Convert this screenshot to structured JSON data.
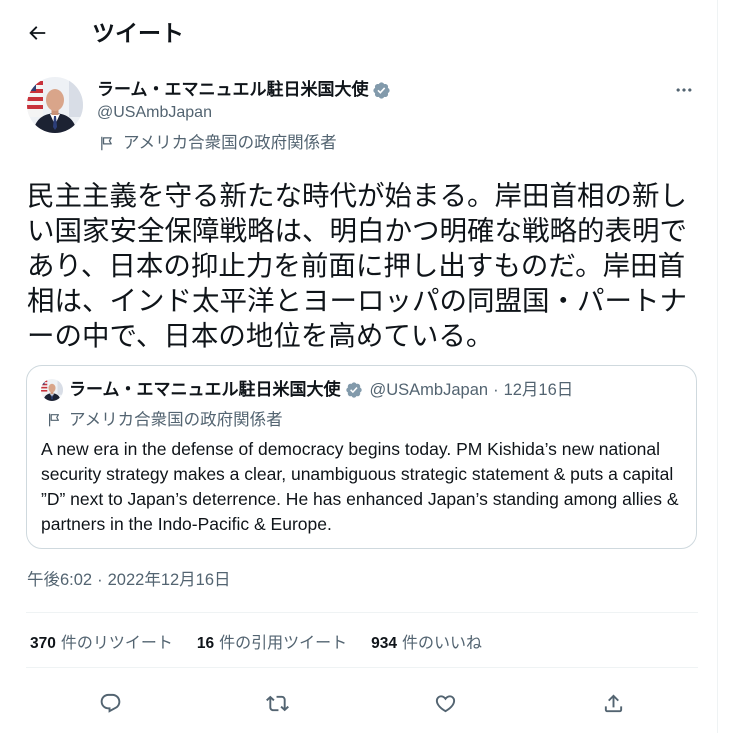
{
  "header": {
    "back_icon": "arrow-left-icon",
    "title": "ツイート"
  },
  "tweet": {
    "author": {
      "name": "ラーム・エマニュエル駐日米国大使",
      "handle": "@USAmbJapan",
      "badge_icon": "verified-badge-icon"
    },
    "more_icon": "more-icon",
    "label": {
      "icon": "flag-icon",
      "text": "アメリカ合衆国の政府関係者"
    },
    "text": "民主主義を守る新たな時代が始まる。岸田首相の新しい国家安全保障戦略は、明白かつ明確な戦略的表明であり、日本の抑止力を前面に押し出すものだ。岸田首相は、インド太平洋とヨーロッパの同盟国・パートナーの中で、日本の地位を高めている。",
    "quoted_tweet": {
      "author": {
        "name": "ラーム・エマニュエル駐日米国大使",
        "handle": "@USAmbJapan",
        "separator": "·",
        "date": "12月16日",
        "badge_icon": "verified-badge-icon"
      },
      "label": {
        "icon": "flag-icon",
        "text": "アメリカ合衆国の政府関係者"
      },
      "text": "A new era in the defense of democracy begins today. PM Kishida’s new national security strategy makes a clear, unambiguous strategic statement & puts a capital ”D” next to Japan’s deterrence. He has enhanced Japan’s standing among allies & partners in the Indo-Pacific & Europe."
    },
    "timestamp": {
      "time": "午後6:02",
      "separator": "·",
      "date": "2022年12月16日"
    },
    "stats": [
      {
        "count": "370",
        "label": "件のリツイート"
      },
      {
        "count": "16",
        "label": "件の引用ツイート"
      },
      {
        "count": "934",
        "label": "件のいいね"
      }
    ],
    "actions": [
      "reply-icon",
      "retweet-icon",
      "heart-icon",
      "share-icon"
    ]
  },
  "colors": {
    "text": "#0f1419",
    "secondary": "#536471",
    "border": "#cfd9de",
    "divider": "#eff3f4",
    "badge": "#829aab"
  }
}
